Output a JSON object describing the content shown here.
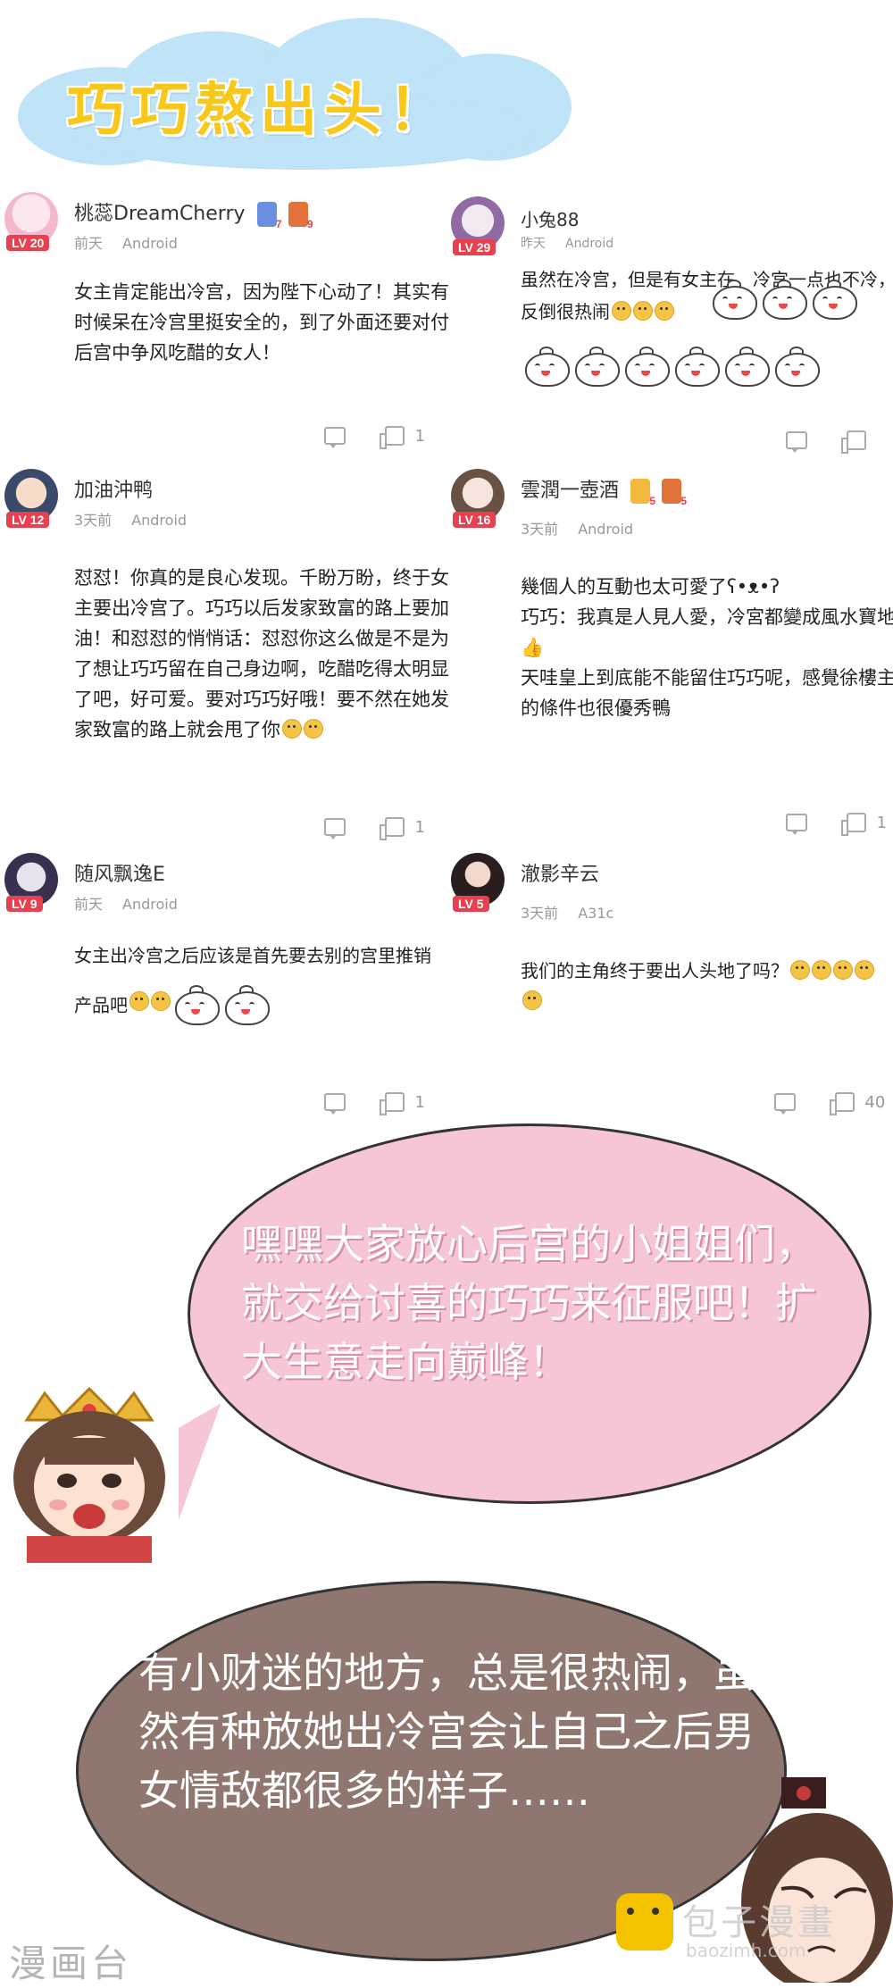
{
  "title": "巧巧熬出头！",
  "comments": [
    {
      "username": "桃蕊DreamCherry",
      "level": "LV 20",
      "time": "前天",
      "device": "Android",
      "badges": [
        "7",
        "9"
      ],
      "text": "女主肯定能出冷宫，因为陛下心动了！其实有时候呆在冷宫里挺安全的，到了外面还要对付后宫中争风吃醋的女人！",
      "likes": "1"
    },
    {
      "username": "小兔88",
      "level": "LV 29",
      "time": "昨天",
      "device": "Android",
      "text": "虽然在冷宫，但是有女主在，冷宫一点也不冷，反倒很热闹",
      "likes": ""
    },
    {
      "username": "加油沖鸭",
      "level": "LV 12",
      "time": "3天前",
      "device": "Android",
      "text": "怼怼！你真的是良心发现。千盼万盼，终于女主要出冷宫了。巧巧以后发家致富的路上要加油！和怼怼的悄悄话：怼怼你这么做是不是为了想让巧巧留在自己身边啊，吃醋吃得太明显了吧，好可爱。要对巧巧好哦！要不然在她发家致富的路上就会甩了你",
      "likes": "1"
    },
    {
      "username": "雲潤一壺酒",
      "level": "LV 16",
      "time": "3天前",
      "device": "Android",
      "badges": [
        "5",
        "5"
      ],
      "text": "幾個人的互動也太可愛了ʕ•ᴥ•ʔ",
      "text2": "巧巧：我真是人見人愛，冷宮都變成風水寶地",
      "text3": "天哇皇上到底能不能留住巧巧呢，感覺徐樓主的條件也很優秀鴨",
      "likes": "1"
    },
    {
      "username": "随风飘逸E",
      "level": "LV 9",
      "time": "前天",
      "device": "Android",
      "text": "女主出冷宫之后应该是首先要去别的宫里推销",
      "text2": "产品吧",
      "likes": "1"
    },
    {
      "username": "澈影辛云",
      "level": "LV 5",
      "time": "3天前",
      "device": "A31c",
      "text": "我们的主角终于要出人头地了吗？",
      "likes": "40"
    }
  ],
  "bubble1": "嘿嘿大家放心后宫的小姐姐们，就交给讨喜的巧巧来征服吧！扩大生意走向巅峰！",
  "bubble2": "有小财迷的地方，总是很热闹，虽然有种放她出冷宫会让自己之后男女情敌都很多的样子……",
  "watermark_left": "漫画台",
  "watermark_right_name": "包子漫畫",
  "watermark_right_url": "baozimh.com",
  "colors": {
    "title_yellow": "#f7c81a",
    "cloud_blue": "#bfe3f7",
    "level_red": "#e8404f",
    "bubble_pink": "#f6c5d7",
    "bubble_brown": "#8f7770"
  }
}
